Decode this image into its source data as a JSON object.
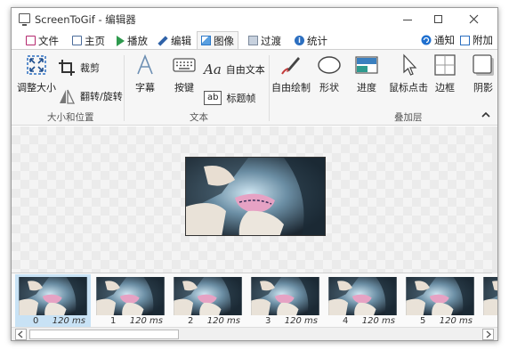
{
  "window": {
    "title": "ScreenToGif - 编辑器"
  },
  "tabs": [
    {
      "label": "文件",
      "icon": "file-icon"
    },
    {
      "label": "主页",
      "icon": "home-icon"
    },
    {
      "label": "播放",
      "icon": "play-icon"
    },
    {
      "label": "编辑",
      "icon": "edit-icon"
    },
    {
      "label": "图像",
      "icon": "image-icon",
      "active": true
    },
    {
      "label": "过渡",
      "icon": "transition-icon"
    },
    {
      "label": "统计",
      "icon": "statistics-icon"
    }
  ],
  "tabs_right": [
    {
      "label": "通知",
      "icon": "notification-icon"
    },
    {
      "label": "附加",
      "icon": "extras-icon"
    }
  ],
  "ribbon": {
    "size_position": {
      "group_label": "大小和位置",
      "resize": "调整大小",
      "crop": "裁剪",
      "flip_rotate": "翻转/旋转"
    },
    "text": {
      "group_label": "文本",
      "caption": "字幕",
      "key_strokes": "按键",
      "free_text": "自由文本",
      "title_frame": "标题帧",
      "free_text_glyph": "Aa",
      "title_frame_glyph": "ab"
    },
    "overlay": {
      "group_label": "叠加层",
      "free_drawing": "自由绘制",
      "shapes": "形状",
      "progress": "进度",
      "mouse_clicks": "鼠标点击",
      "border": "边框",
      "shadow": "阴影"
    }
  },
  "frames": [
    {
      "index": "0",
      "delay": "120 ms"
    },
    {
      "index": "1",
      "delay": "120 ms"
    },
    {
      "index": "2",
      "delay": "120 ms"
    },
    {
      "index": "3",
      "delay": "120 ms"
    },
    {
      "index": "4",
      "delay": "120 ms"
    },
    {
      "index": "5",
      "delay": "120 ms"
    }
  ],
  "colors": {
    "accent": "#2c78c8",
    "selected_frame": "#c8e2f5"
  }
}
